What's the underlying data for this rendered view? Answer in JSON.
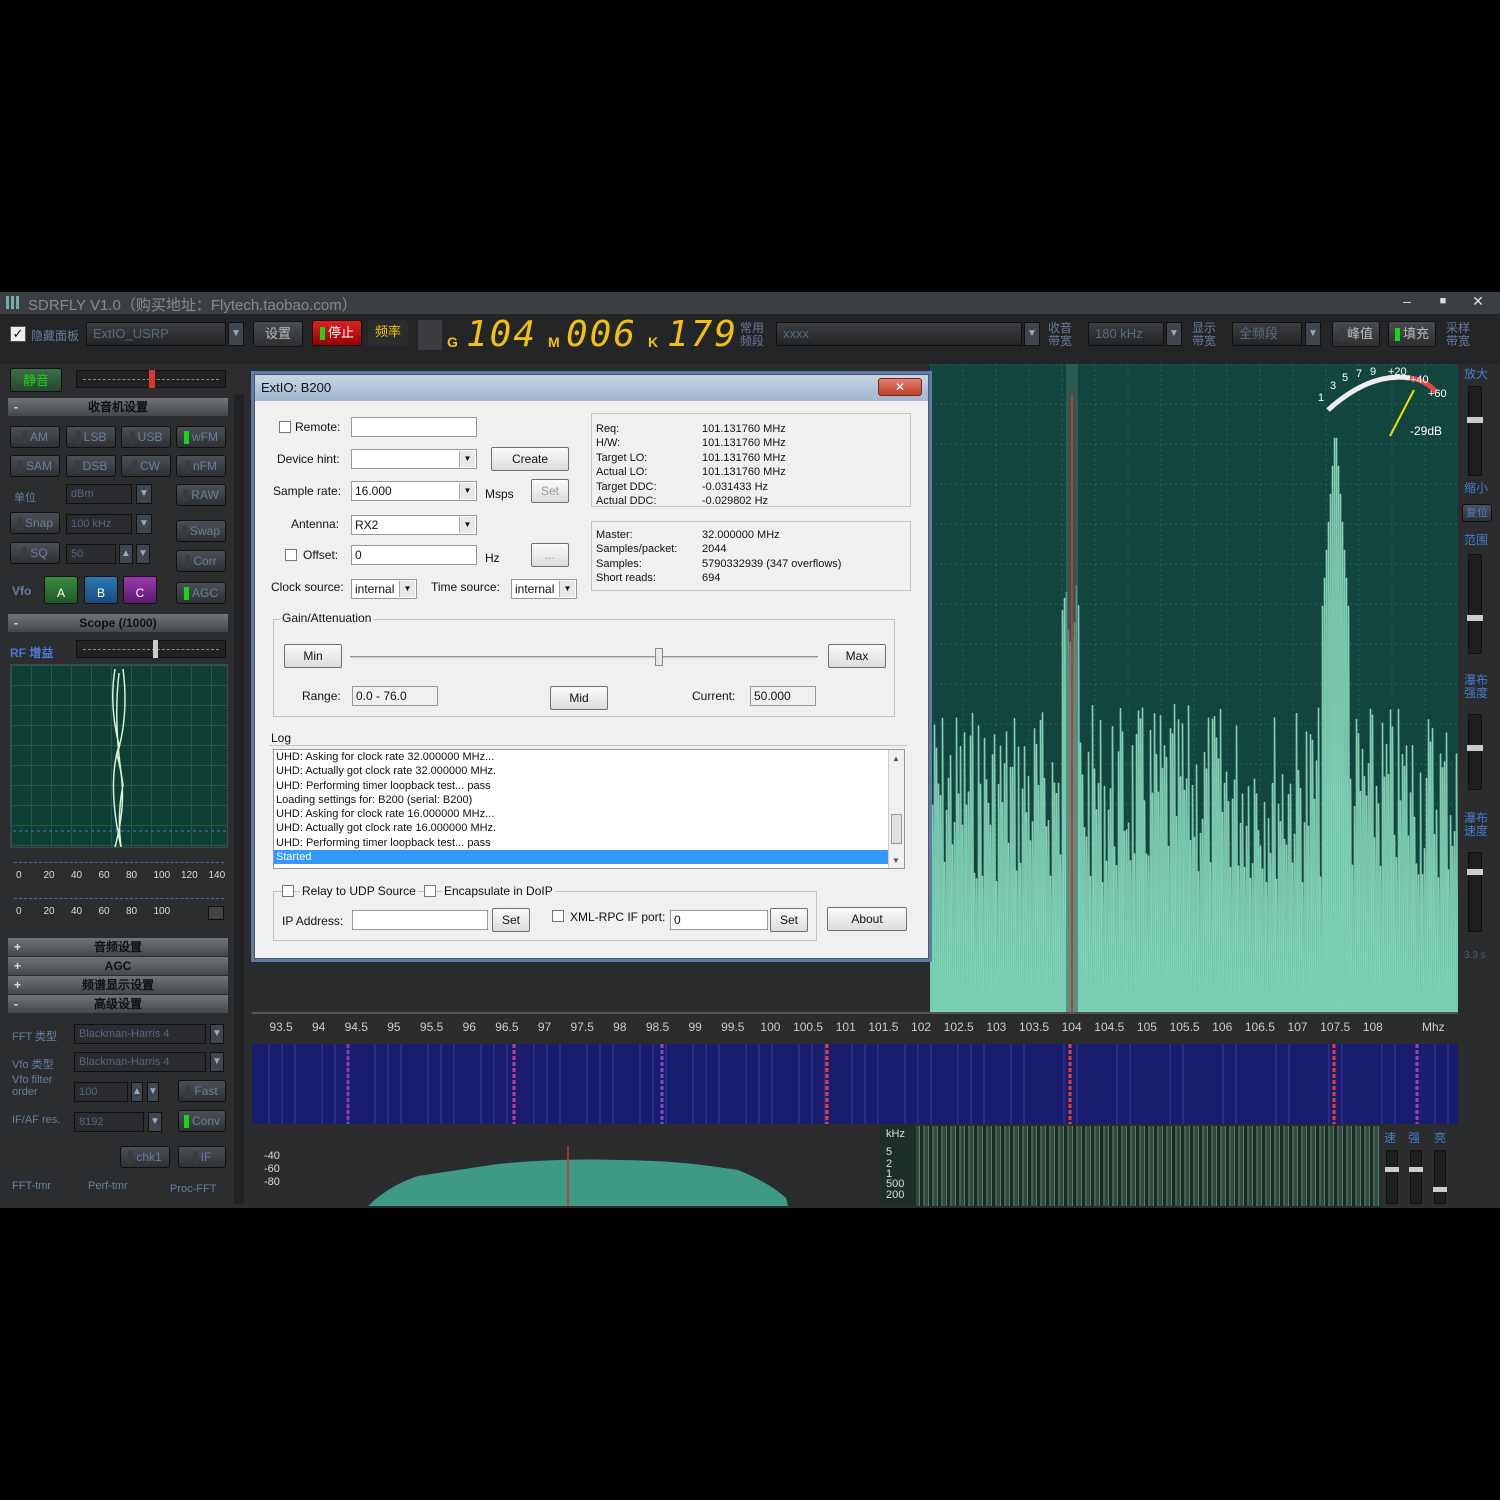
{
  "window": {
    "title": "SDRFLY V1.0（购买地址：Flytech.taobao.com）",
    "controls": [
      "‒",
      "■",
      "✕"
    ]
  },
  "toolbar": {
    "hide_panel_label": "隐藏面板",
    "device": "ExtIO_USRP",
    "settings": "设置",
    "stop": "停止",
    "freq_label": "频率",
    "freq_units": {
      "g": "G",
      "m": "M",
      "k": "K"
    },
    "freq_groups": [
      "104",
      "006",
      "179"
    ],
    "common_freq": "常用\n频段",
    "freq_name": "xxxx",
    "rx_bw_label": "收音\n带宽",
    "rx_bw": "180 kHz",
    "display_bw_label": "显示\n带宽",
    "display_bw": "全频段",
    "peak": "峰值",
    "fill": "填充",
    "sample_bw_label": "采样\n带宽"
  },
  "sidebar": {
    "mute": "静音",
    "receiver_section": "收音机设置",
    "modes": [
      "AM",
      "LSB",
      "USB",
      "wFM",
      "SAM",
      "DSB",
      "CW",
      "nFM"
    ],
    "raw": "RAW",
    "unit_label": "单位",
    "unit_value": "dBm",
    "snap": "Snap",
    "snap_value": "100 kHz",
    "swap": "Swap",
    "sq": "SQ",
    "sq_value": "50",
    "corr": "Corr",
    "vfo_label": "Vfo",
    "vfo_buttons": [
      "A",
      "B",
      "C"
    ],
    "agc_btn": "AGC",
    "scope_section": "Scope (/1000)",
    "rf_gain_label": "RF 增益",
    "scale1": [
      "0",
      "20",
      "40",
      "60",
      "80",
      "100",
      "120",
      "140"
    ],
    "scale2": [
      "0",
      "20",
      "40",
      "60",
      "80",
      "100"
    ],
    "audio_section": "音频设置",
    "agc_section": "AGC",
    "spectrum_section": "频谱显示设置",
    "advanced_section": "高级设置",
    "fft_type_label": "FFT 类型",
    "fft_type": "Blackman-Harris 4",
    "vfo_type_label": "Vfo 类型",
    "vfo_type": "Blackman-Harris 4",
    "vfo_filter_label": "Vfo filter\norder",
    "vfo_filter": "100",
    "fast": "Fast",
    "ifaf_label": "IF/AF res.",
    "ifaf": "8192",
    "conv": "Conv",
    "chk1": "chk1",
    "if_btn": "IF",
    "timers": [
      "FFT-tmr",
      "Perf-tmr",
      "Proc-FFT"
    ]
  },
  "right_panel": {
    "zoom_in": "放大",
    "zoom_out": "缩小",
    "reset": "复位",
    "range": "范围",
    "wf_strength": "瀑布\n强度",
    "wf_speed": "瀑布\n速度",
    "speed_value": "3.3 s",
    "bottom_labels": [
      "速",
      "强",
      "亮"
    ]
  },
  "smeter": {
    "labels": [
      "1",
      "3",
      "5",
      "7",
      "9",
      "+20",
      "+40",
      "+60"
    ],
    "reading": "-29dB"
  },
  "axis": {
    "ticks": [
      "93.5",
      "94",
      "94.5",
      "95",
      "95.5",
      "96",
      "96.5",
      "97",
      "97.5",
      "98",
      "98.5",
      "99",
      "99.5",
      "100",
      "100.5",
      "101",
      "101.5",
      "102",
      "102.5",
      "103",
      "103.5",
      "104",
      "104.5",
      "105",
      "105.5",
      "106",
      "106.5",
      "107",
      "107.5",
      "108"
    ],
    "unit": "Mhz"
  },
  "bottom_panel": {
    "af_scale": [
      "-40",
      "-60",
      "-80"
    ],
    "khz_label": "kHz",
    "khz_scale": [
      "5",
      "2",
      "1",
      "500",
      "200"
    ]
  },
  "dialog": {
    "title": "ExtIO: B200",
    "remote_label": "Remote:",
    "device_hint_label": "Device hint:",
    "create": "Create",
    "sample_rate_label": "Sample rate:",
    "sample_rate": "16.000",
    "msps": "Msps",
    "set": "Set",
    "antenna_label": "Antenna:",
    "antenna": "RX2",
    "offset_label": "Offset:",
    "offset": "0",
    "hz": "Hz",
    "ellipsis": "...",
    "clock_source_label": "Clock source:",
    "clock_source": "internal",
    "time_source_label": "Time source:",
    "time_source": "internal",
    "status1_keys": [
      "Req:",
      "H/W:",
      "Target LO:",
      "Actual LO:",
      "Target DDC:",
      "Actual DDC:"
    ],
    "status1_vals": [
      "101.131760 MHz",
      "101.131760 MHz",
      "101.131760 MHz",
      "101.131760 MHz",
      "-0.031433 Hz",
      "-0.029802 Hz"
    ],
    "status2_keys": [
      "Master:",
      "Samples/packet:",
      "Samples:",
      "Short reads:"
    ],
    "status2_vals": [
      "32.000000 MHz",
      "2044",
      "5790332939 (347 overflows)",
      "694"
    ],
    "gain_group": "Gain/Attenuation",
    "min": "Min",
    "max": "Max",
    "range_label": "Range:",
    "range": "0.0 - 76.0",
    "mid": "Mid",
    "current_label": "Current:",
    "current": "50.000",
    "gain_fraction": 0.66,
    "log_label": "Log",
    "log_lines": [
      "UHD: Asking for clock rate 32.000000 MHz...",
      "UHD: Actually got clock rate 32.000000 MHz.",
      "UHD: Performing timer loopback test... pass",
      "Loading settings for: B200 (serial: B200)",
      "UHD: Asking for clock rate 16.000000 MHz...",
      "UHD: Actually got clock rate 16.000000 MHz.",
      "UHD: Performing timer loopback test... pass",
      "Started"
    ],
    "relay_udp": "Relay to UDP Source",
    "encapsulate": "Encapsulate in DoIP",
    "ip_label": "IP Address:",
    "xmlrpc_label": "XML-RPC IF port:",
    "xmlrpc_port": "0",
    "about": "About"
  }
}
